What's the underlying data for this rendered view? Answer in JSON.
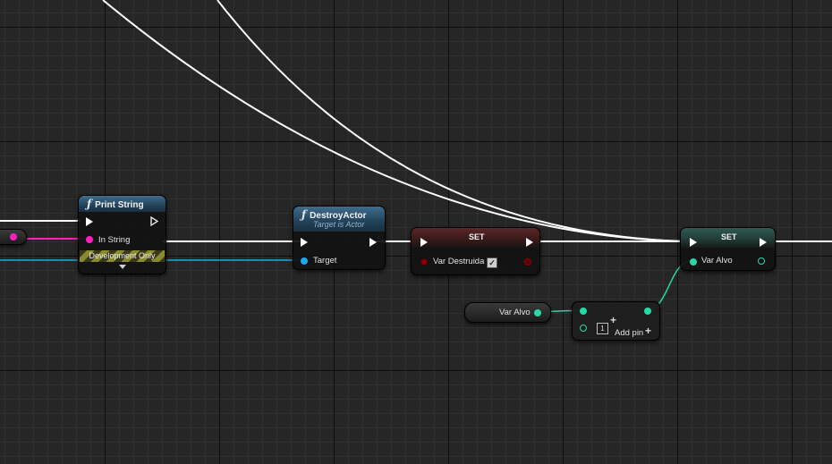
{
  "nodes": {
    "print_string": {
      "title": "Print String",
      "in_string_label": "In String",
      "dev_only_label": "Development Only"
    },
    "destroy_actor": {
      "title": "DestroyActor",
      "subtitle": "Target is Actor",
      "target_label": "Target"
    },
    "set_destruida": {
      "title": "SET",
      "var_label": "Var Destruida",
      "checkbox_value": "✓"
    },
    "set_alvo": {
      "title": "SET",
      "var_label": "Var Alvo"
    },
    "get_alvo": {
      "label": "Var Alvo"
    },
    "make_array": {
      "index_label": "1",
      "add_pin_label": "Add pin",
      "add_pin_glyph": "+",
      "plus_glyph": "+"
    }
  },
  "colors": {
    "exec_wire": "#ffffff",
    "string_pin": "#ff1fbf",
    "object_pin": "#1ea7ea",
    "bool_pin": "#940000",
    "alvo_pin": "#27d8a8",
    "header_function": "#2a4a63",
    "header_set_bool": "#4a2222",
    "header_set_alvo": "#2a4a44"
  },
  "icons": {
    "function": "ƒ"
  }
}
